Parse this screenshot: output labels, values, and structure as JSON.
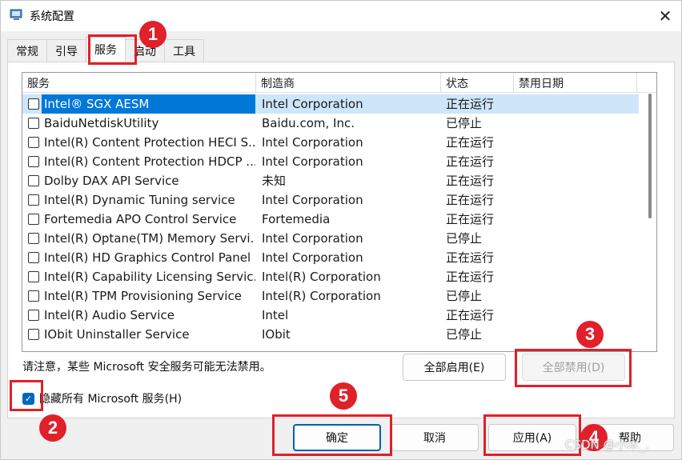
{
  "window": {
    "title": "系统配置",
    "close_glyph": "✕"
  },
  "tabs": [
    "常规",
    "引导",
    "服务",
    "启动",
    "工具"
  ],
  "columns": [
    "服务",
    "制造商",
    "状态",
    "禁用日期"
  ],
  "services": [
    {
      "name": "Intel® SGX AESM",
      "maker": "Intel Corporation",
      "status": "正在运行"
    },
    {
      "name": "BaiduNetdiskUtility",
      "maker": "Baidu.com, Inc.",
      "status": "已停止"
    },
    {
      "name": "Intel(R) Content Protection HECI S...",
      "maker": "Intel Corporation",
      "status": "正在运行"
    },
    {
      "name": "Intel(R) Content Protection HDCP ...",
      "maker": "Intel Corporation",
      "status": "正在运行"
    },
    {
      "name": "Dolby DAX API Service",
      "maker": "未知",
      "status": "正在运行"
    },
    {
      "name": "Intel(R) Dynamic Tuning service",
      "maker": "Intel Corporation",
      "status": "正在运行"
    },
    {
      "name": "Fortemedia APO Control Service",
      "maker": "Fortemedia",
      "status": "正在运行"
    },
    {
      "name": "Intel(R) Optane(TM) Memory Servi...",
      "maker": "Intel Corporation",
      "status": "已停止"
    },
    {
      "name": "Intel(R) HD Graphics Control Panel ...",
      "maker": "Intel Corporation",
      "status": "正在运行"
    },
    {
      "name": "Intel(R) Capability Licensing Servic...",
      "maker": "Intel(R) Corporation",
      "status": "正在运行"
    },
    {
      "name": "Intel(R) TPM Provisioning Service",
      "maker": "Intel(R) Corporation",
      "status": "已停止"
    },
    {
      "name": "Intel(R) Audio Service",
      "maker": "Intel",
      "status": "正在运行"
    },
    {
      "name": "IObit Uninstaller Service",
      "maker": "IObit",
      "status": "已停止"
    }
  ],
  "note": "请注意，某些 Microsoft 安全服务可能无法禁用。",
  "buttons": {
    "enable_all": "全部启用(E)",
    "disable_all": "全部禁用(D)",
    "ok": "确定",
    "cancel": "取消",
    "apply": "应用(A)",
    "help": "帮助"
  },
  "hide_ms_label": "隐藏所有 Microsoft 服务(H)",
  "hide_ms_checked": true,
  "badges": [
    "1",
    "2",
    "3",
    "4",
    "5"
  ],
  "watermark": "CSDN @小木_.",
  "colors": {
    "accent": "#0078d7",
    "annotation_red": "#e0202a"
  }
}
